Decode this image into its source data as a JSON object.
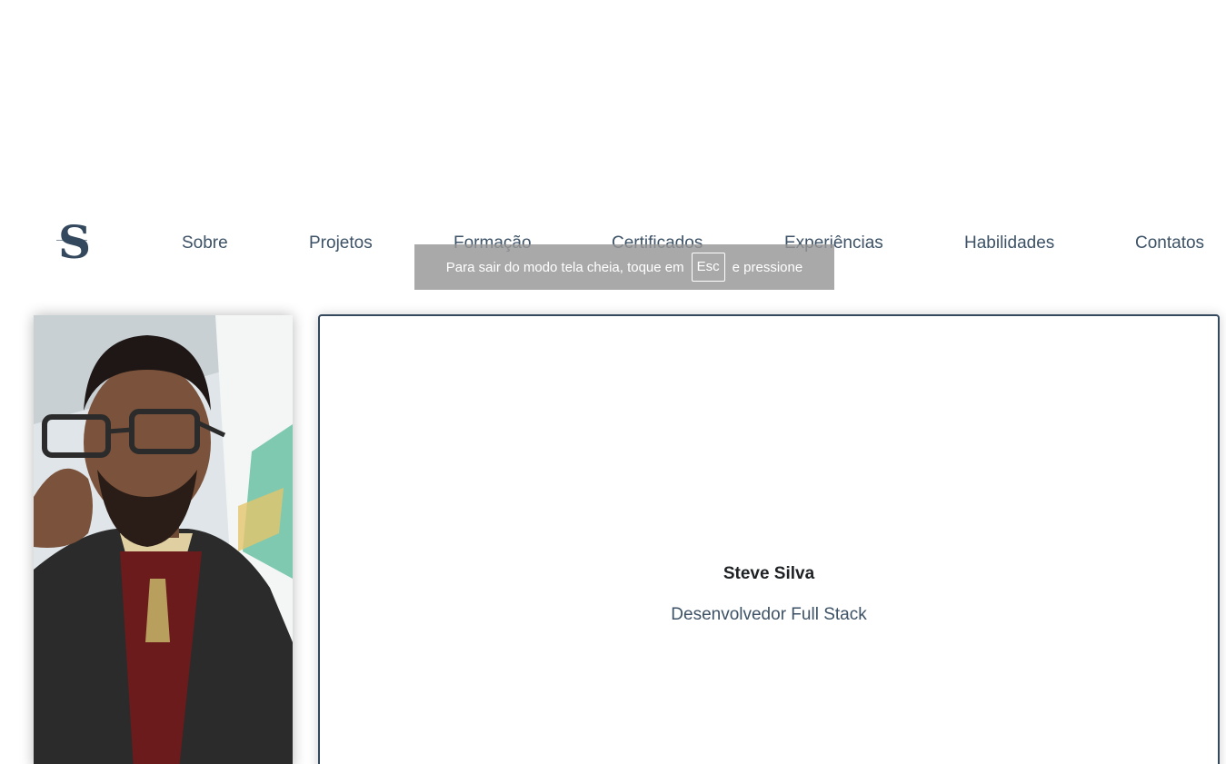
{
  "logo": {
    "letter": "S",
    "icon": "initial-logo"
  },
  "nav": {
    "items": [
      {
        "label": "Sobre"
      },
      {
        "label": "Projetos"
      },
      {
        "label": "Formação"
      },
      {
        "label": "Certificados"
      },
      {
        "label": "Experiências"
      },
      {
        "label": "Habilidades"
      },
      {
        "label": "Contatos"
      }
    ]
  },
  "fullscreen_notice": {
    "before": "Para sair do modo tela cheia, toque em",
    "key": "Esc",
    "after": "e pressione"
  },
  "profile": {
    "photo_icon": "profile-photo",
    "name": "Steve Silva",
    "role": "Desenvolvedor Full Stack"
  },
  "colors": {
    "accent": "#34495e",
    "nav_text": "#3d5266",
    "toast_bg": "#969696"
  }
}
